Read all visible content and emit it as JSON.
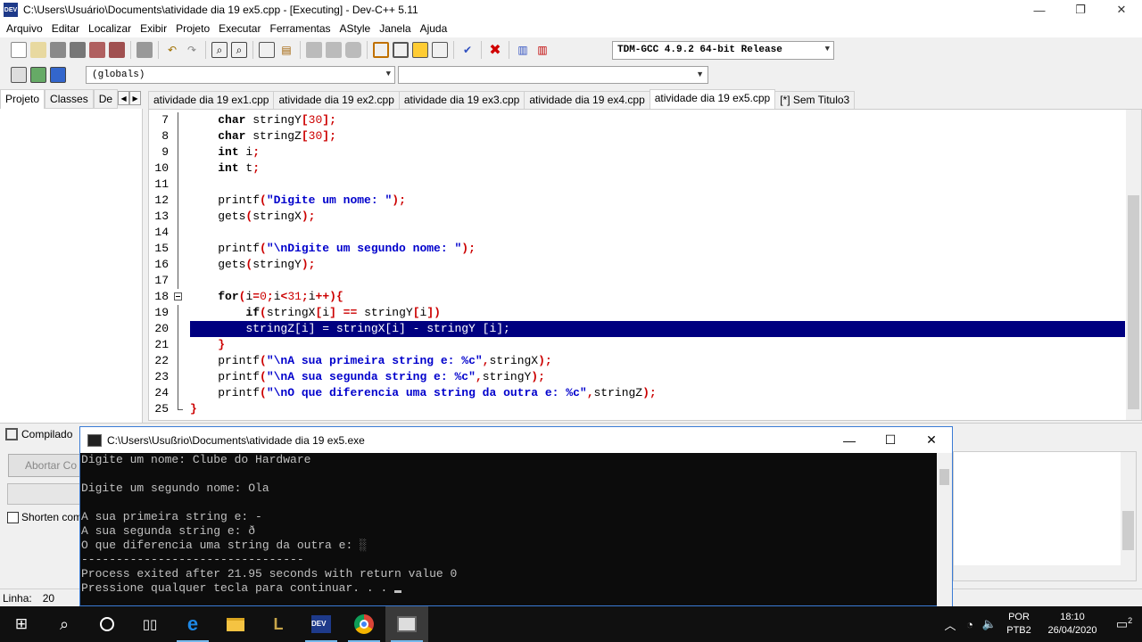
{
  "window": {
    "title": "C:\\Users\\Usuário\\Documents\\atividade dia 19 ex5.cpp - [Executing] - Dev-C++ 5.11",
    "minimize": "—",
    "maximize": "❐",
    "close": "✕"
  },
  "menu": [
    "Arquivo",
    "Editar",
    "Localizar",
    "Exibir",
    "Projeto",
    "Executar",
    "Ferramentas",
    "AStyle",
    "Janela",
    "Ajuda"
  ],
  "toolbar": {
    "compiler": "TDM-GCC 4.9.2 64-bit Release",
    "scope": "(globals)"
  },
  "left_tabs": [
    "Projeto",
    "Classes",
    "De"
  ],
  "editor_tabs": [
    "atividade dia 19 ex1.cpp",
    "atividade dia 19 ex2.cpp",
    "atividade dia 19 ex3.cpp",
    "atividade dia 19 ex4.cpp",
    "atividade dia 19 ex5.cpp",
    "[*] Sem Titulo3"
  ],
  "active_tab_index": 4,
  "code_lines": [
    {
      "n": "7",
      "html": "    <span class=\"kw\">char</span> stringY<span class=\"sym\">[</span><span class=\"num\">30</span><span class=\"sym\">];</span>"
    },
    {
      "n": "8",
      "html": "    <span class=\"kw\">char</span> stringZ<span class=\"sym\">[</span><span class=\"num\">30</span><span class=\"sym\">];</span>"
    },
    {
      "n": "9",
      "html": "    <span class=\"kw\">int</span> i<span class=\"sym\">;</span>"
    },
    {
      "n": "10",
      "html": "    <span class=\"kw\">int</span> t<span class=\"sym\">;</span>"
    },
    {
      "n": "11",
      "html": ""
    },
    {
      "n": "12",
      "html": "    printf<span class=\"sym\">(</span><span class=\"str\">\"Digite um nome: \"</span><span class=\"sym\">);</span>"
    },
    {
      "n": "13",
      "html": "    gets<span class=\"sym\">(</span>stringX<span class=\"sym\">);</span>"
    },
    {
      "n": "14",
      "html": ""
    },
    {
      "n": "15",
      "html": "    printf<span class=\"sym\">(</span><span class=\"str\">\"\\nDigite um segundo nome: \"</span><span class=\"sym\">);</span>"
    },
    {
      "n": "16",
      "html": "    gets<span class=\"sym\">(</span>stringY<span class=\"sym\">);</span>"
    },
    {
      "n": "17",
      "html": ""
    },
    {
      "n": "18",
      "html": "    <span class=\"kw\">for</span><span class=\"sym\">(</span>i<span class=\"sym\">=</span><span class=\"num\">0</span><span class=\"sym\">;</span>i<span class=\"sym\">&lt;</span><span class=\"num\">31</span><span class=\"sym\">;</span>i<span class=\"sym\">++){</span>",
      "fold": true
    },
    {
      "n": "19",
      "html": "        <span class=\"kw\">if</span><span class=\"sym\">(</span>stringX<span class=\"sym\">[</span>i<span class=\"sym\">] ==</span> stringY<span class=\"sym\">[</span>i<span class=\"sym\">])</span>"
    },
    {
      "n": "20",
      "html": "        stringZ[i] = stringX[i] - stringY [i];",
      "highlight": true
    },
    {
      "n": "21",
      "html": "    <span class=\"sym\">}</span>"
    },
    {
      "n": "22",
      "html": "    printf<span class=\"sym\">(</span><span class=\"str\">\"\\nA sua primeira string e: %c\"</span><span class=\"sym\">,</span>stringX<span class=\"sym\">);</span>"
    },
    {
      "n": "23",
      "html": "    printf<span class=\"sym\">(</span><span class=\"str\">\"\\nA sua segunda string e: %c\"</span><span class=\"sym\">,</span>stringY<span class=\"sym\">);</span>"
    },
    {
      "n": "24",
      "html": "    printf<span class=\"sym\">(</span><span class=\"str\">\"\\nO que diferencia uma string da outra e: %c\"</span><span class=\"sym\">,</span>stringZ<span class=\"sym\">);</span>"
    },
    {
      "n": "25",
      "html": "<span class=\"sym\">}</span>"
    }
  ],
  "bottom": {
    "tab_label": "Compilado",
    "abort_label": "Abortar Co",
    "shorten_label": "Shorten com"
  },
  "status": {
    "line_label": "Linha:",
    "line_value": "20"
  },
  "console": {
    "title": "C:\\Users\\Usußrio\\Documents\\atividade dia 19 ex5.exe",
    "lines": [
      "Digite um nome: Clube do Hardware",
      "",
      "Digite um segundo nome: Ola",
      "",
      "A sua primeira string e: -",
      "A sua segunda string e: ð",
      "O que diferencia uma string da outra e: ░",
      "--------------------------------",
      "Process exited after 21.95 seconds with return value 0",
      "Pressione qualquer tecla para continuar. . . "
    ]
  },
  "tray": {
    "lang1": "POR",
    "lang2": "PTB2",
    "time": "18:10",
    "date": "26/04/2020",
    "notif_count": "2"
  }
}
